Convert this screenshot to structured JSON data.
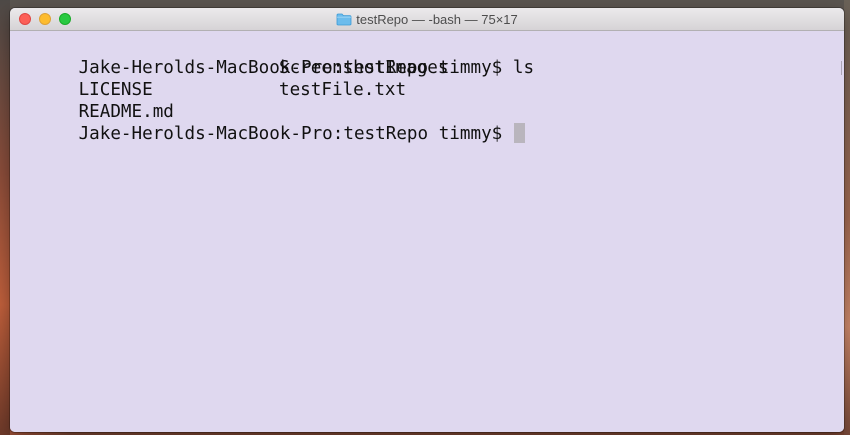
{
  "window": {
    "title": "testRepo — -bash — 75×17",
    "folder_icon": "folder-icon",
    "colors": {
      "terminal_background": "#dfd8ef",
      "close": "#fc5f57",
      "minimize": "#fdbc2e",
      "zoom": "#29c941"
    }
  },
  "terminal": {
    "lines": [
      {
        "left": "Jake-Herolds-MacBook-Pro:testRepo timmy$ ls",
        "right": ""
      },
      {
        "left": "LICENSE",
        "right": "ScreenshotImages"
      },
      {
        "left": "README.md",
        "right": "testFile.txt"
      },
      {
        "left": "Jake-Herolds-MacBook-Pro:testRepo timmy$",
        "right": ""
      }
    ]
  }
}
